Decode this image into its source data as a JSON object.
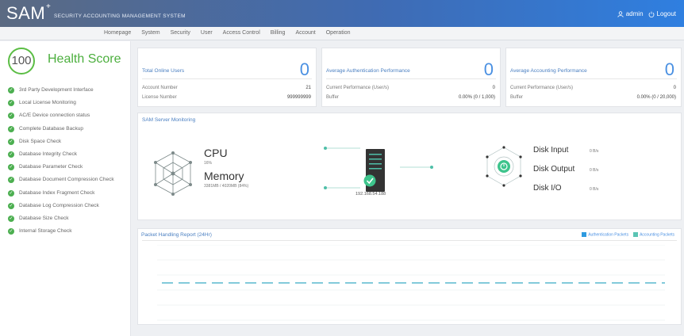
{
  "header": {
    "logo": "SAM",
    "logo_plus": "+",
    "system_name": "SECURITY ACCOUNTING MANAGEMENT SYSTEM",
    "user": "admin",
    "logout": "Logout"
  },
  "nav": {
    "items": [
      "Homepage",
      "System",
      "Security",
      "User",
      "Access Control",
      "Billing",
      "Account",
      "Operation"
    ]
  },
  "health": {
    "score": "100",
    "title": "Health Score",
    "checks": [
      "3rd Party Development Interface",
      "Local License Monitoring",
      "AC/E Device connection status",
      "Complete Database Backup",
      "Disk Space Check",
      "Database Integrity Check",
      "Database Parameter Check",
      "Database Document Compression Check",
      "Database Index Fragment Check",
      "Database Log Compression Check",
      "Database Size Check",
      "Internal Storage Check"
    ]
  },
  "cards": {
    "online": {
      "title": "Total Online Users",
      "value": "0",
      "row1_label": "Account Number",
      "row1_value": "21",
      "row2_label": "License Number",
      "row2_value": "999999999"
    },
    "auth": {
      "title": "Average Authentication Performance",
      "value": "0",
      "row1_label": "Current Performance (User/s)",
      "row1_value": "0",
      "row2_label": "Buffer",
      "row2_value": "0.00% (0 / 1,000)"
    },
    "acct": {
      "title": "Average Accounting Performance",
      "value": "0",
      "row1_label": "Current Performance (User/s)",
      "row1_value": "0",
      "row2_label": "Buffer",
      "row2_value": "0.00% (0 / 20,000)"
    }
  },
  "monitor": {
    "title": "SAM Server Monitoring",
    "cpu_label": "CPU",
    "cpu_value": "16%",
    "memory_label": "Memory",
    "memory_value": "3381MB / 4020MB (84%)",
    "server_ip": "192.168.54.188",
    "disk_input_label": "Disk Input",
    "disk_input_value": "0 B/s",
    "disk_output_label": "Disk Output",
    "disk_output_value": "0 B/s",
    "disk_io_label": "Disk I/O",
    "disk_io_value": "0 B/s"
  },
  "packet": {
    "title": "Packet Handling Report (24Hr)",
    "legend_auth": "Authentication Packets",
    "legend_acct": "Accounting Packets",
    "colors": {
      "auth": "#2f9be0",
      "acct": "#5bc4b4"
    }
  }
}
